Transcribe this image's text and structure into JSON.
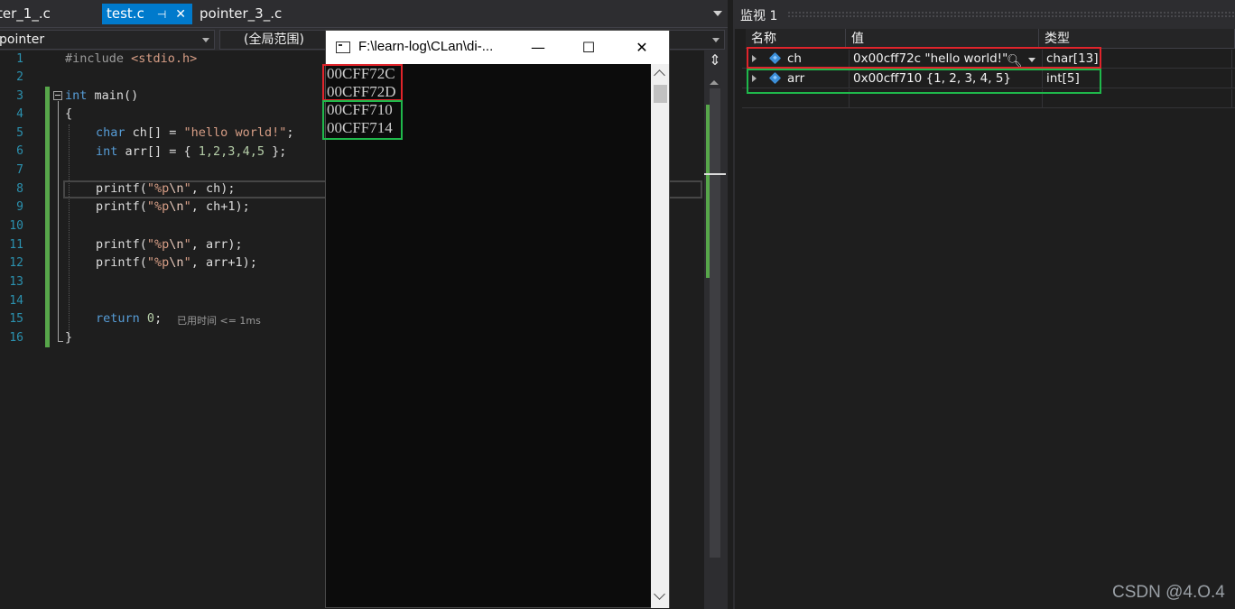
{
  "tabs": [
    {
      "label": "ter_1_.c"
    },
    {
      "label": "test.c",
      "pin": "⊣",
      "close": "✕"
    },
    {
      "label": "pointer_3_.c"
    }
  ],
  "nav": {
    "project": "pointer",
    "scope": "(全局范围)"
  },
  "line_numbers": [
    "1",
    "2",
    "3",
    "4",
    "5",
    "6",
    "7",
    "8",
    "9",
    "10",
    "11",
    "12",
    "13",
    "14",
    "15",
    "16"
  ],
  "code": {
    "l1_pp": "#include ",
    "l1_inc": "<stdio.h>",
    "l3_kw": "int",
    "l3_rest": " main()",
    "l4": "{",
    "l5_kw": "char",
    "l5_a": " ch[] = ",
    "l5_str": "\"hello world!\"",
    "l5_end": ";",
    "l6_kw": "int",
    "l6_a": " arr[] = { ",
    "l6_nums": "1,2,3,4,5",
    "l6_end": " };",
    "printf": "printf(",
    "fmt_open": "\"%p",
    "fmt_esc": "\\n",
    "fmt_close": "\"",
    "l8_args": ", ch);",
    "l9_args": ", ch+1);",
    "l11_args": ", arr);",
    "l12_args": ", arr+1);",
    "l15_kw": "return",
    "l15_num": "0",
    "l15_end": ";",
    "l16": "}",
    "perf_tip": "已用时间 <= 1ms"
  },
  "console": {
    "title": "F:\\learn-log\\CLan\\di-...",
    "minimize": "—",
    "maximize": "☐",
    "close": "✕",
    "output": [
      "00CFF72C",
      "00CFF72D",
      "00CFF710",
      "00CFF714"
    ]
  },
  "watch": {
    "title": "监视 1",
    "headers": {
      "name": "名称",
      "value": "值",
      "type": "类型"
    },
    "rows": [
      {
        "name": "ch",
        "value": "0x00cff72c \"hello world!\"",
        "type": "char[13]"
      },
      {
        "name": "arr",
        "value": "0x00cff710 {1, 2, 3, 4, 5}",
        "type": "int[5]"
      }
    ]
  },
  "colors": {
    "highlight_red": "#e0242b",
    "highlight_green": "#1fb84b",
    "tab_active": "#007acc"
  },
  "watermark": "CSDN @4.O.4"
}
